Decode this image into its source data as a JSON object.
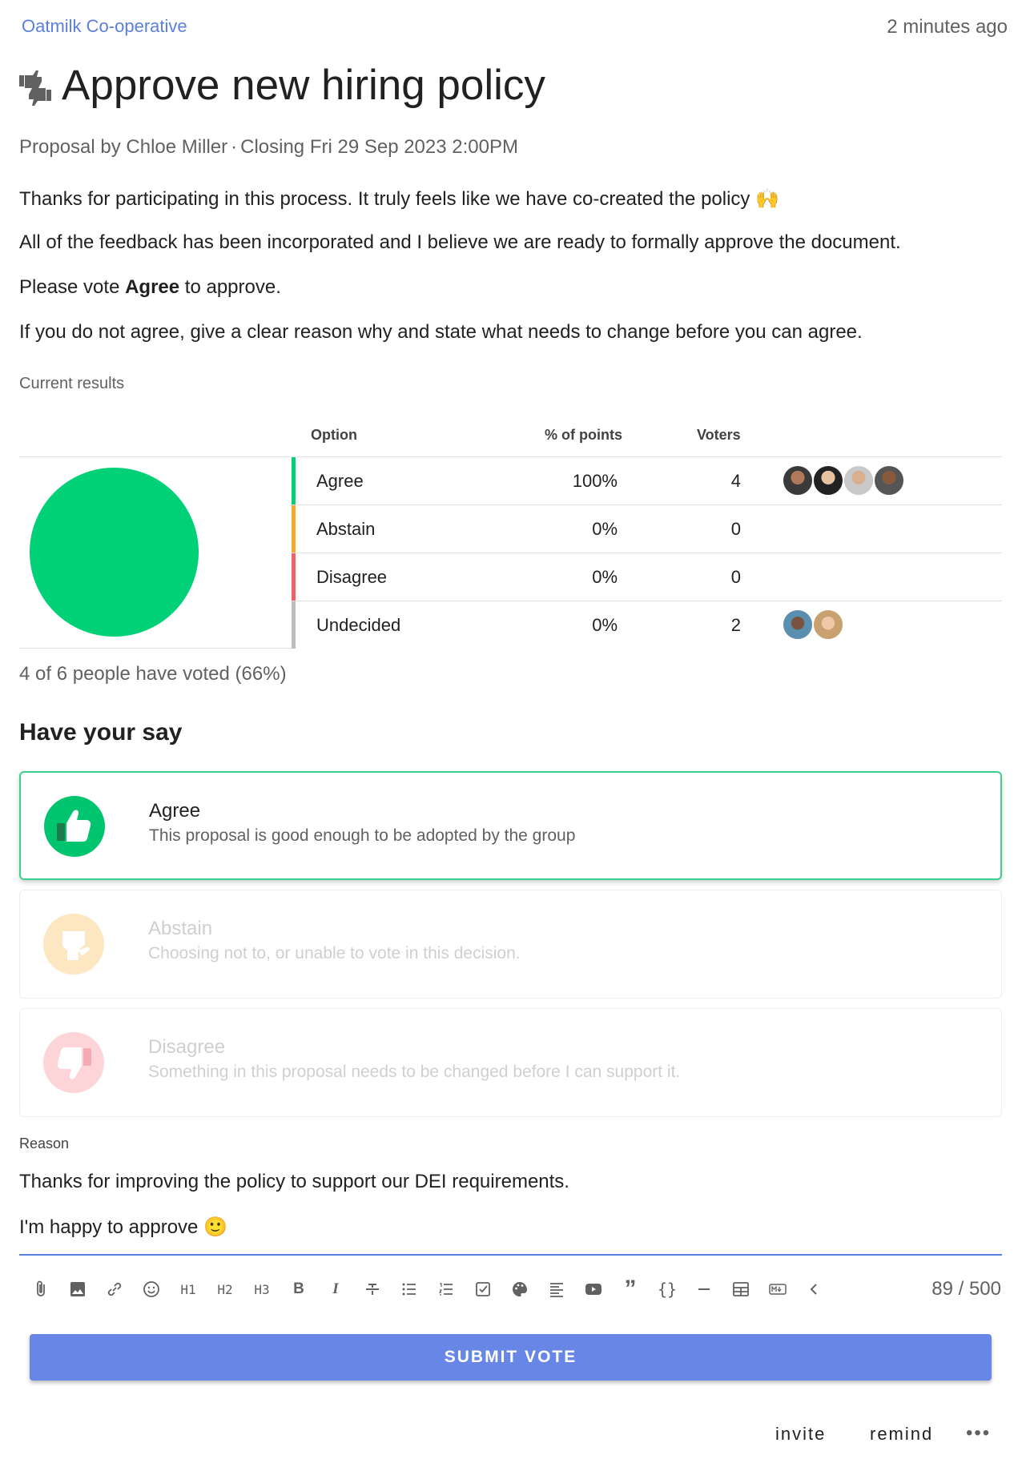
{
  "header": {
    "group_name": "Oatmilk Co-operative",
    "time_ago": "2 minutes ago",
    "title": "Approve new hiring policy",
    "author_line": "Proposal by Chloe Miller",
    "closing_line": "Closing Fri 29 Sep 2023 2:00PM"
  },
  "body": {
    "p1": "Thanks for participating in this process. It truly feels like we have co-created the policy 🙌",
    "p2": "All of the feedback has been incorporated and I believe we are ready to formally approve the document.",
    "p3_before": "Please vote ",
    "p3_bold": "Agree",
    "p3_after": " to approve.",
    "p4": "If you do not agree, give a clear reason why and state what needs to change before you can agree."
  },
  "results": {
    "label": "Current results",
    "columns": {
      "option": "Option",
      "points": "% of points",
      "voters": "Voters"
    },
    "rows": [
      {
        "option": "Agree",
        "points": "100%",
        "voters": "4",
        "color": "#00d076"
      },
      {
        "option": "Abstain",
        "points": "0%",
        "voters": "0",
        "color": "#f6a82c"
      },
      {
        "option": "Disagree",
        "points": "0%",
        "voters": "0",
        "color": "#f0606a"
      },
      {
        "option": "Undecided",
        "points": "0%",
        "voters": "2",
        "color": "#bdbdbd"
      }
    ],
    "pie_color": "#00d076",
    "summary": "4 of 6 people have voted (66%)"
  },
  "vote": {
    "heading": "Have your say",
    "choices": [
      {
        "title": "Agree",
        "desc": "This proposal is good enough to be adopted by the group",
        "icon": "thumbs-up-icon",
        "color": "#00c56e"
      },
      {
        "title": "Abstain",
        "desc": "Choosing not to, or unable to vote in this decision.",
        "icon": "hand-icon",
        "color": "#fde6c2"
      },
      {
        "title": "Disagree",
        "desc": "Something in this proposal needs to be changed before I can support it.",
        "icon": "thumbs-down-icon",
        "color": "#fdd5d8"
      }
    ],
    "reason_label": "Reason",
    "reason_p1": "Thanks for improving the policy to support our DEI requirements.",
    "reason_p2": "I'm happy to approve 🙂",
    "counter": "89 / 500",
    "submit_label": "SUBMIT VOTE"
  },
  "toolbar": {
    "h1": "H1",
    "h2": "H2",
    "h3": "H3",
    "bold": "B",
    "italic": "I",
    "quote": "”",
    "code": "{}"
  },
  "footer": {
    "invite": "invite",
    "remind": "remind",
    "more": "•••"
  },
  "colors": {
    "accent": "#6786e6",
    "link": "#5b7fdf",
    "agree": "#00d076"
  }
}
